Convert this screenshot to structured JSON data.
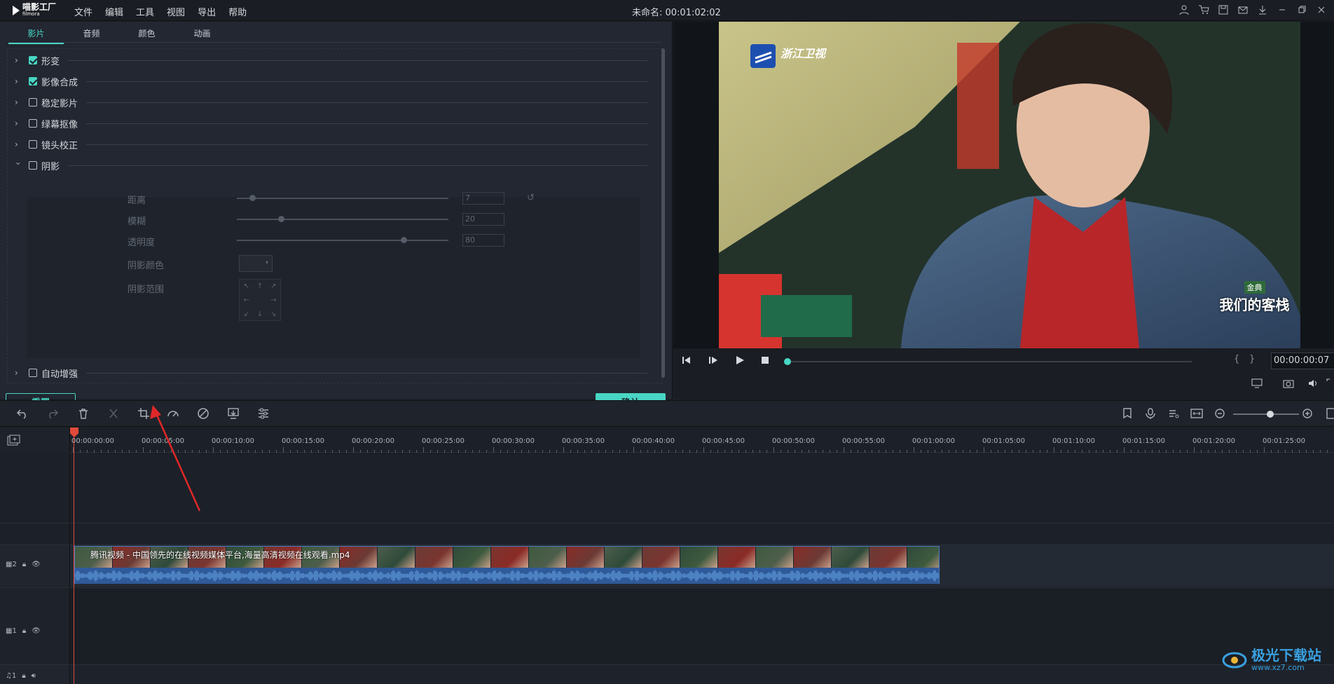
{
  "app": {
    "logo_text": "喵影工厂",
    "logo_sub": "filmora",
    "menu": [
      "文件",
      "编辑",
      "工具",
      "视图",
      "导出",
      "帮助"
    ],
    "window_title": "未命名: 00:01:02:02"
  },
  "left_panel": {
    "tabs": [
      "影片",
      "音频",
      "颜色",
      "动画"
    ],
    "active_tab": "影片",
    "properties": [
      {
        "label": "形变",
        "checked": true,
        "expanded": false
      },
      {
        "label": "影像合成",
        "checked": true,
        "expanded": false
      },
      {
        "label": "稳定影片",
        "checked": false,
        "expanded": false
      },
      {
        "label": "绿幕抠像",
        "checked": false,
        "expanded": false
      },
      {
        "label": "镜头校正",
        "checked": false,
        "expanded": false
      },
      {
        "label": "阴影",
        "checked": false,
        "expanded": true
      },
      {
        "label": "自动增强",
        "checked": false,
        "expanded": false
      }
    ],
    "shadow": {
      "distance_label": "距离",
      "distance_value": "7",
      "distance_level": 0.06,
      "blur_label": "模糊",
      "blur_value": "20",
      "blur_level": 0.2,
      "opacity_label": "透明度",
      "opacity_value": "80",
      "opacity_level": 0.8,
      "color_label": "阴影颜色",
      "range_label": "阴影范围"
    },
    "reset_label": "重置",
    "ok_label": "确认"
  },
  "preview": {
    "channel_logo": "浙江卫视",
    "show_badge_top": "金典",
    "show_badge": "我们的客栈",
    "timecode": "00:00:00:07",
    "progress": 0.0
  },
  "timeline": {
    "ruler": [
      "00:00:00:00",
      "00:00:05:00",
      "00:00:10:00",
      "00:00:15:00",
      "00:00:20:00",
      "00:00:25:00",
      "00:00:30:00",
      "00:00:35:00",
      "00:00:40:00",
      "00:00:45:00",
      "00:00:50:00",
      "00:00:55:00",
      "00:01:00:00",
      "00:01:05:00",
      "00:01:10:00",
      "00:01:15:00",
      "00:01:20:00",
      "00:01:25:00"
    ],
    "clip_title": "腾讯视频 - 中国领先的在线视频媒体平台,海量高清视频在线观看.mp4",
    "track2_label": "2",
    "track1_label": "1",
    "audio_label": "1"
  },
  "watermark": {
    "text": "极光下载站",
    "url": "www.xz7.com"
  },
  "colors": {
    "accent": "#48d6c4",
    "playhead": "#e04a3a",
    "clip": "#2b4c7a"
  }
}
